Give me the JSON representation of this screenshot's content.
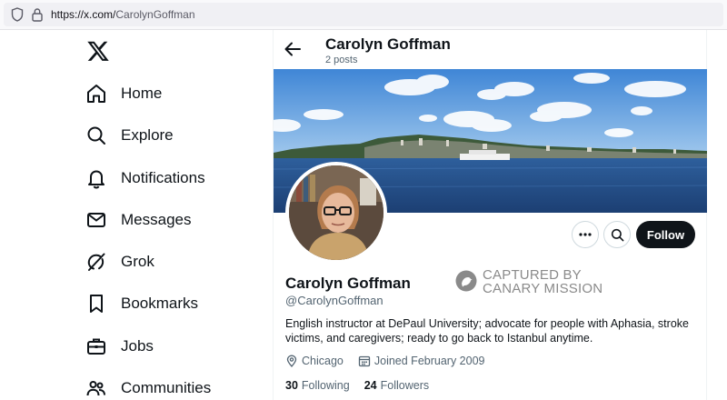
{
  "browser": {
    "url_host": "https://x.com/",
    "url_path": "CarolynGoffman"
  },
  "sidebar": {
    "logo": "x-logo-icon",
    "items": [
      {
        "label": "Home",
        "icon": "home-icon"
      },
      {
        "label": "Explore",
        "icon": "search-icon"
      },
      {
        "label": "Notifications",
        "icon": "bell-icon"
      },
      {
        "label": "Messages",
        "icon": "envelope-icon"
      },
      {
        "label": "Grok",
        "icon": "grok-icon"
      },
      {
        "label": "Bookmarks",
        "icon": "bookmark-icon"
      },
      {
        "label": "Jobs",
        "icon": "briefcase-icon"
      },
      {
        "label": "Communities",
        "icon": "people-icon"
      }
    ]
  },
  "header": {
    "name": "Carolyn Goffman",
    "posts": "2 posts"
  },
  "profile": {
    "name": "Carolyn Goffman",
    "handle": "@CarolynGoffman",
    "bio": "English instructor at DePaul University; advocate for people with Aphasia, stroke victims, and caregivers; ready to go back to Istanbul anytime.",
    "location": "Chicago",
    "joined": "Joined February 2009",
    "following_count": "30",
    "following_label": "Following",
    "followers_count": "24",
    "followers_label": "Followers",
    "follow_button": "Follow"
  },
  "watermark": {
    "line1": "CAPTURED BY",
    "line2": "CANARY MISSION"
  },
  "colors": {
    "primary_text": "#0f1419",
    "secondary_text": "#536471",
    "follow_button_bg": "#0f1419",
    "watermark": "#8a8a8a"
  }
}
